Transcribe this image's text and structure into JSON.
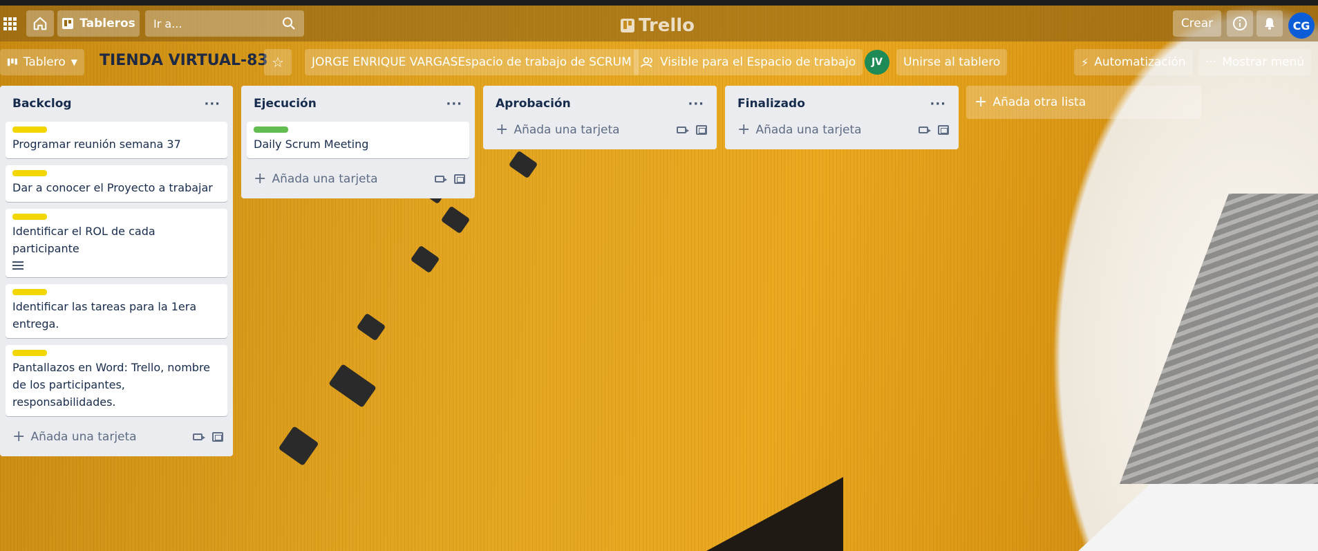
{
  "header": {
    "boards_label": "Tableros",
    "search_placeholder": "Ir a...",
    "logo_text": "Trello",
    "create_label": "Crear",
    "user_initials": "CG"
  },
  "board_bar": {
    "view_label": "Tablero",
    "board_title": "TIENDA VIRTUAL-83",
    "workspace_label": "JORGE ENRIQUE VARGASEspacio de trabajo de SCRUM",
    "visibility_label": "Visible para el Espacio de trabajo",
    "member_initials": "JV",
    "join_label": "Unirse al tablero",
    "automation_label": "Automatización",
    "menu_label": "Mostrar menú"
  },
  "lists": [
    {
      "title": "Backclog",
      "cards": [
        {
          "label_color": "yellow",
          "text": "Programar reunión semana 37"
        },
        {
          "label_color": "yellow",
          "text": "Dar a conocer el Proyecto a trabajar"
        },
        {
          "label_color": "yellow",
          "text": "Identificar el ROL de cada participante",
          "has_description": true
        },
        {
          "label_color": "yellow",
          "text": "Identificar las tareas para la 1era entrega."
        },
        {
          "label_color": "yellow",
          "text": "Pantallazos en Word: Trello, nombre de los participantes, responsabilidades."
        }
      ],
      "add_card_label": "Añada una tarjeta"
    },
    {
      "title": "Ejecución",
      "cards": [
        {
          "label_color": "green",
          "text": "Daily Scrum Meeting"
        }
      ],
      "add_card_label": "Añada una tarjeta"
    },
    {
      "title": "Aprobación",
      "cards": [],
      "add_card_label": "Añada una tarjeta"
    },
    {
      "title": "Finalizado",
      "cards": [],
      "add_card_label": "Añada una tarjeta"
    }
  ],
  "add_list_label": "Añada otra lista",
  "colors": {
    "label_yellow": "#f2d600",
    "label_green": "#61bd4f",
    "title_text": "#1e2a44",
    "avatar_cg": "#0b5dd7",
    "avatar_jv": "#1e8a55"
  }
}
